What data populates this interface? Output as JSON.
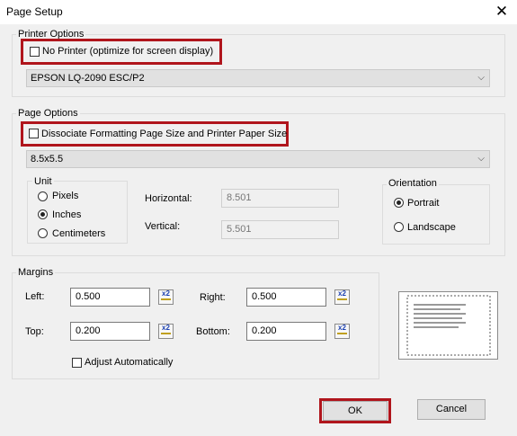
{
  "window": {
    "title": "Page Setup",
    "close_glyph": "✕"
  },
  "printer_options": {
    "legend": "Printer Options",
    "no_printer_label": "No Printer (optimize for screen display)",
    "no_printer_checked": false,
    "printer_select": "EPSON LQ-2090 ESC/P2"
  },
  "page_options": {
    "legend": "Page Options",
    "dissociate_label": "Dissociate Formatting Page Size and Printer Paper Size",
    "dissociate_checked": false,
    "size_select": "8.5x5.5",
    "unit": {
      "legend": "Unit",
      "options": [
        "Pixels",
        "Inches",
        "Centimeters"
      ],
      "selected": "Inches"
    },
    "horizontal_label": "Horizontal:",
    "horizontal_value": "8.501",
    "vertical_label": "Vertical:",
    "vertical_value": "5.501",
    "orientation": {
      "legend": "Orientation",
      "options": [
        "Portrait",
        "Landscape"
      ],
      "selected": "Portrait"
    }
  },
  "margins": {
    "legend": "Margins",
    "left_label": "Left:",
    "left_value": "0.500",
    "right_label": "Right:",
    "right_value": "0.500",
    "top_label": "Top:",
    "top_value": "0.200",
    "bottom_label": "Bottom:",
    "bottom_value": "0.200",
    "adjust_label": "Adjust Automatically",
    "adjust_checked": false,
    "spin_text": "x2"
  },
  "buttons": {
    "ok": "OK",
    "cancel": "Cancel"
  },
  "highlight_color": "#b0151c"
}
